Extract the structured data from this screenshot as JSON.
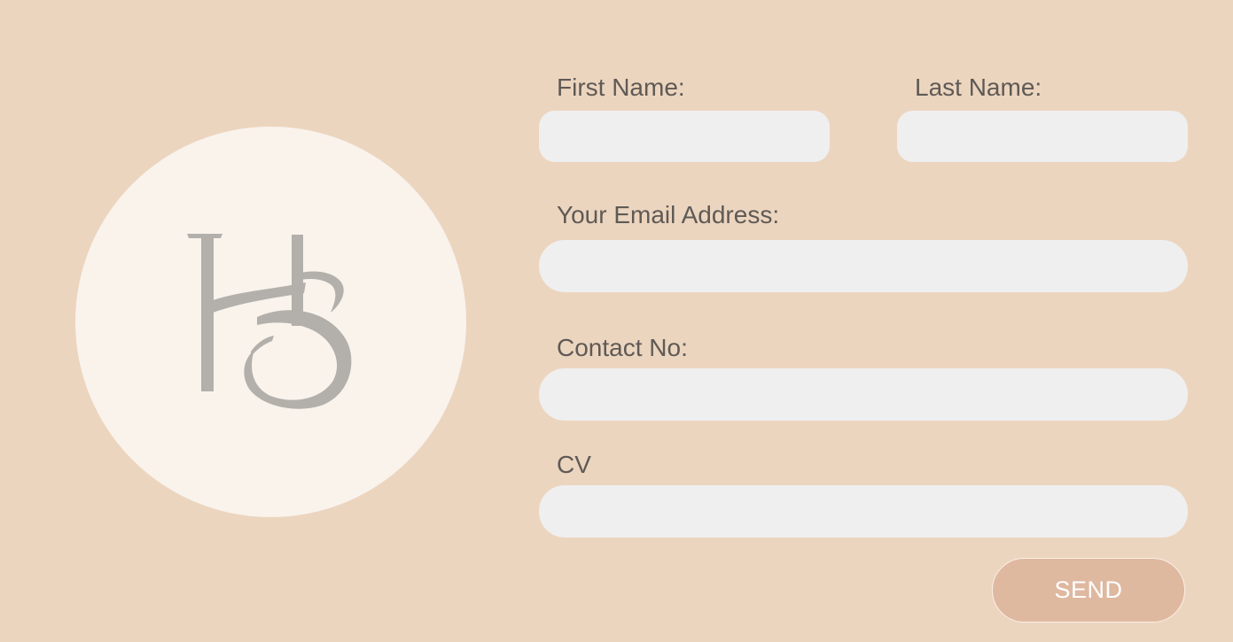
{
  "brand": {
    "logo_text": "KS",
    "circle_color": "#f9f3ec",
    "mark_color": "#b3b0ab"
  },
  "form": {
    "first_name": {
      "label": "First Name:",
      "value": ""
    },
    "last_name": {
      "label": "Last Name:",
      "value": ""
    },
    "email": {
      "label": "Your Email Address:",
      "value": ""
    },
    "contact": {
      "label": "Contact No:",
      "value": ""
    },
    "cv": {
      "label": "CV",
      "value": ""
    },
    "submit_label": "SEND"
  },
  "colors": {
    "background": "#ecd5bf",
    "field": "#efefef",
    "label": "#5f5a55",
    "button": "#dfb8a0",
    "button_text": "#ffffff"
  }
}
